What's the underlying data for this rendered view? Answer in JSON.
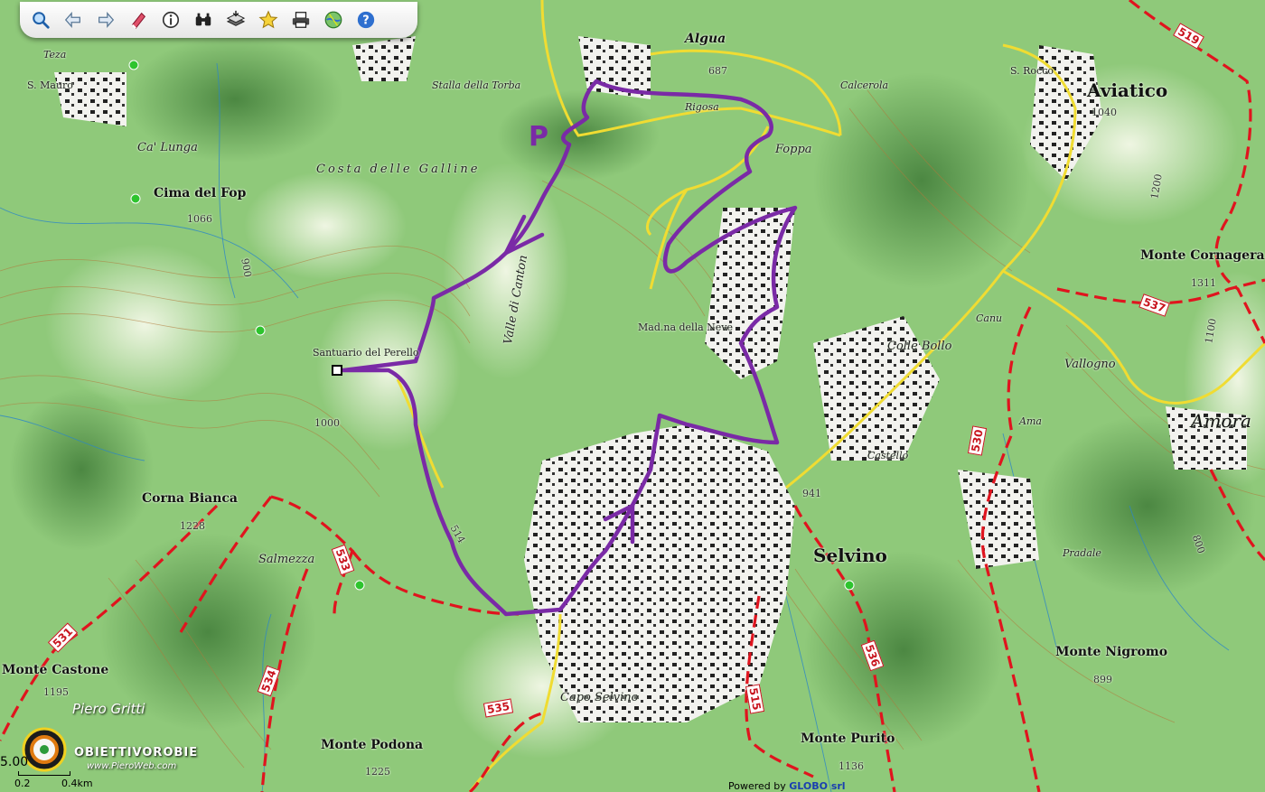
{
  "toolbar": {
    "buttons": [
      {
        "name": "zoom-search-icon"
      },
      {
        "name": "back-arrow-icon"
      },
      {
        "name": "forward-arrow-icon"
      },
      {
        "name": "eraser-icon"
      },
      {
        "name": "info-icon"
      },
      {
        "name": "binoculars-icon"
      },
      {
        "name": "layers-icon"
      },
      {
        "name": "star-icon"
      },
      {
        "name": "printer-icon"
      },
      {
        "name": "globe-icon"
      },
      {
        "name": "help-icon"
      }
    ]
  },
  "places": {
    "aviatico": "Aviatico",
    "aviatico_elev": "1040",
    "selvino": "Selvino",
    "selvino_elev": "941",
    "amora": "Amora",
    "cima_del_fop": "Cima del Fop",
    "cima_del_fop_elev": "1066",
    "corna_bianca": "Corna Bianca",
    "corna_bianca_elev": "1228",
    "monte_castone": "Monte Castone",
    "monte_castone_elev": "1195",
    "monte_podona": "Monte Podona",
    "monte_podona_elev": "1225",
    "monte_purito": "Monte Purito",
    "monte_purito_elev": "1136",
    "monte_nigromo": "Monte Nigromo",
    "monte_nigromo_elev": "899",
    "monte_cornagera": "Monte Cornagera",
    "monte_cornagera_elev": "1311",
    "colle_bollo": "Colle Bollo",
    "vallogno": "Vallogno",
    "santuario": "Santuario del Perello",
    "madonna_neve": "Mad.na della Neve",
    "valle_canton": "Valle di Canton",
    "costa_galline": "Costa delle Galline",
    "capo_selvino": "Capo Selvino",
    "salmezza": "Salmezza",
    "foppa": "Foppa",
    "rigosa": "Rigosa",
    "calcerola": "Calcerola",
    "stalla_torba": "Stalla della Torba",
    "ca_lunga": "Ca' Lunga",
    "s_rocco": "S. Rocco",
    "s_mauro": "S. Mauro",
    "algua": "Algua",
    "algua_elev": "687",
    "teza": "Teza",
    "castello": "Castello",
    "ama": "Ama",
    "cavani": "Canu",
    "pradale": "Pradale",
    "parking": "P"
  },
  "trail_numbers": [
    "519",
    "537",
    "530",
    "536",
    "515",
    "535",
    "534",
    "531",
    "533",
    "514"
  ],
  "contour_labels": [
    "1000",
    "900",
    "800",
    "1100",
    "1200"
  ],
  "footer": {
    "author": "Piero Gritti",
    "brand": "OBIETTIVOROBIE",
    "brand_url": "www.PieroWeb.com",
    "scale_left": "5.00",
    "scale_mid": "0.2",
    "scale_right": "0.4km",
    "powered_prefix": "Powered by ",
    "powered_name": "GLOBO srl"
  },
  "colors": {
    "route": "#7a2aa6",
    "road": "#f0dc32",
    "trail_red": "#e0141e",
    "terrain": "#8fc97a"
  }
}
